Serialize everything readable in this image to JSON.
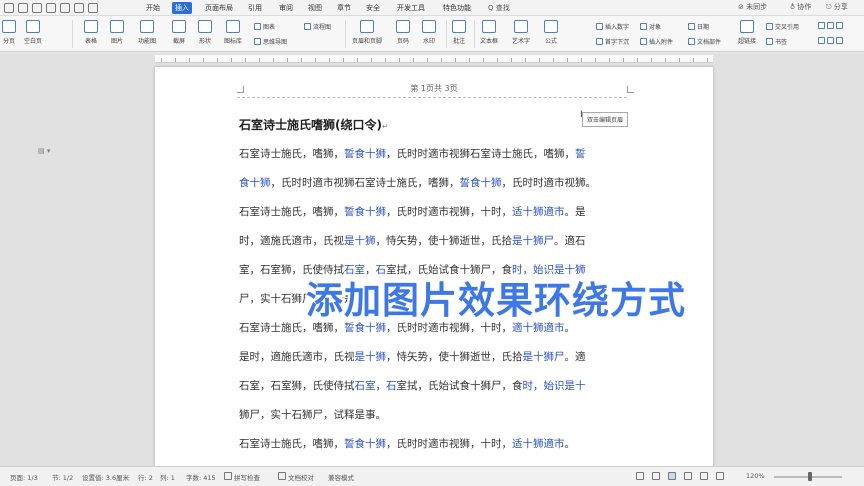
{
  "menubar": {
    "tabs": [
      "开始",
      "插入",
      "页面布局",
      "引用",
      "审阅",
      "视图",
      "章节",
      "安全",
      "开发工具",
      "特色功能"
    ],
    "active_tab": "插入",
    "search": "Q 查找",
    "right_links": [
      "⊘ 未同步",
      "♁ 协作",
      "⎋ 分享"
    ]
  },
  "ribbon": {
    "buttons": [
      "分页",
      "空白页",
      "表格",
      "图片",
      "功能图",
      "截屏",
      "形状",
      "图标库",
      "页眉和页脚",
      "页码",
      "水印",
      "批注",
      "文本框",
      "艺术字",
      "公式",
      "对象",
      "日期",
      "超链接",
      "书签"
    ],
    "small_items": [
      "图表",
      "思维导图",
      "流程图",
      "插入数字",
      "首字下沉",
      "插入附件",
      "文档部件",
      "交叉引用"
    ]
  },
  "document": {
    "header_label": "第 1页共 3页",
    "tooltip": "双击编辑页眉",
    "cursor_symbol": "I",
    "title": "石室诗士施氏嗜狮(绕口令)",
    "paragraph_mark": "↵",
    "para_icon": "▤ ▾",
    "lines": [
      [
        {
          "t": "石室诗士施氏，嗜狮，"
        },
        {
          "t": "誓食十狮",
          "h": true
        },
        {
          "t": "，氏时时適市视狮石室诗士施氏，嗜狮，"
        },
        {
          "t": "誓",
          "h": true
        }
      ],
      [
        {
          "t": "食十狮",
          "h": true
        },
        {
          "t": "，氏时时適市视狮石室诗士施氏，嗜狮，"
        },
        {
          "t": "誓食十狮",
          "h": true
        },
        {
          "t": "，氏时时適市视狮。"
        }
      ],
      [
        {
          "t": "石室诗士施氏，嗜狮，"
        },
        {
          "t": "誓食十狮",
          "h": true
        },
        {
          "t": "，氏时时適市视狮，十时，"
        },
        {
          "t": "适十狮適市",
          "h": true
        },
        {
          "t": "。是"
        }
      ],
      [
        {
          "t": "时，適施氏適市，氏视"
        },
        {
          "t": "是十狮",
          "h": true
        },
        {
          "t": "，恃矢势，使十狮逝世，氏拾"
        },
        {
          "t": "是十狮尸",
          "h": true
        },
        {
          "t": "。適石"
        }
      ],
      [
        {
          "t": "室，石室狮，氏使侍拭"
        },
        {
          "t": "石室",
          "h": true
        },
        {
          "t": "，"
        },
        {
          "t": "石",
          "h": true
        },
        {
          "t": "室拭，氏始试食十狮尸，食"
        },
        {
          "t": "时，始识是十狮",
          "h": true
        }
      ],
      [
        {
          "t": "尸，实十石狮尸，试释是事。"
        }
      ],
      [
        {
          "t": "    石室诗士施氏，嗜狮，"
        },
        {
          "t": "誓食十狮",
          "h": true
        },
        {
          "t": "，氏时时適市视狮，十时，"
        },
        {
          "t": "適十狮適市",
          "h": true
        },
        {
          "t": "。"
        }
      ],
      [
        {
          "t": "是时，適施氏適市，氏视"
        },
        {
          "t": "是十狮",
          "h": true
        },
        {
          "t": "，恃矢势，使十狮逝世，氏拾"
        },
        {
          "t": "是十狮尸",
          "h": true
        },
        {
          "t": "。適"
        }
      ],
      [
        {
          "t": "石室，石室狮，氏使侍拭"
        },
        {
          "t": "石室",
          "h": true
        },
        {
          "t": "，"
        },
        {
          "t": "石",
          "h": true
        },
        {
          "t": "室拭，氏始试食十狮尸，食"
        },
        {
          "t": "时，始识是十",
          "h": true
        }
      ],
      [
        {
          "t": "狮尸，实十石狮尸，试释是事。"
        }
      ],
      [
        {
          "t": "    石室诗士施氏，嗜狮，"
        },
        {
          "t": "誓食十狮",
          "h": true
        },
        {
          "t": "，氏时时適市视狮，十时，"
        },
        {
          "t": "适十狮適市",
          "h": true
        },
        {
          "t": "。"
        }
      ]
    ]
  },
  "overlay_text": "添加图片效果环绕方式",
  "statusbar": {
    "page": "页面: 1/3",
    "section": "节: 1/2",
    "setting": "设置值: 3.6厘米",
    "line": "行: 2",
    "column": "列: 1",
    "words": "字数: 415",
    "spell": "拼写检查",
    "proof": "文档校对",
    "compat": "兼容模式",
    "zoom": "120%"
  },
  "colors": {
    "accent": "#2b6fd6",
    "highlight_text": "#2a52c9",
    "overlay": "#3d78e6"
  }
}
